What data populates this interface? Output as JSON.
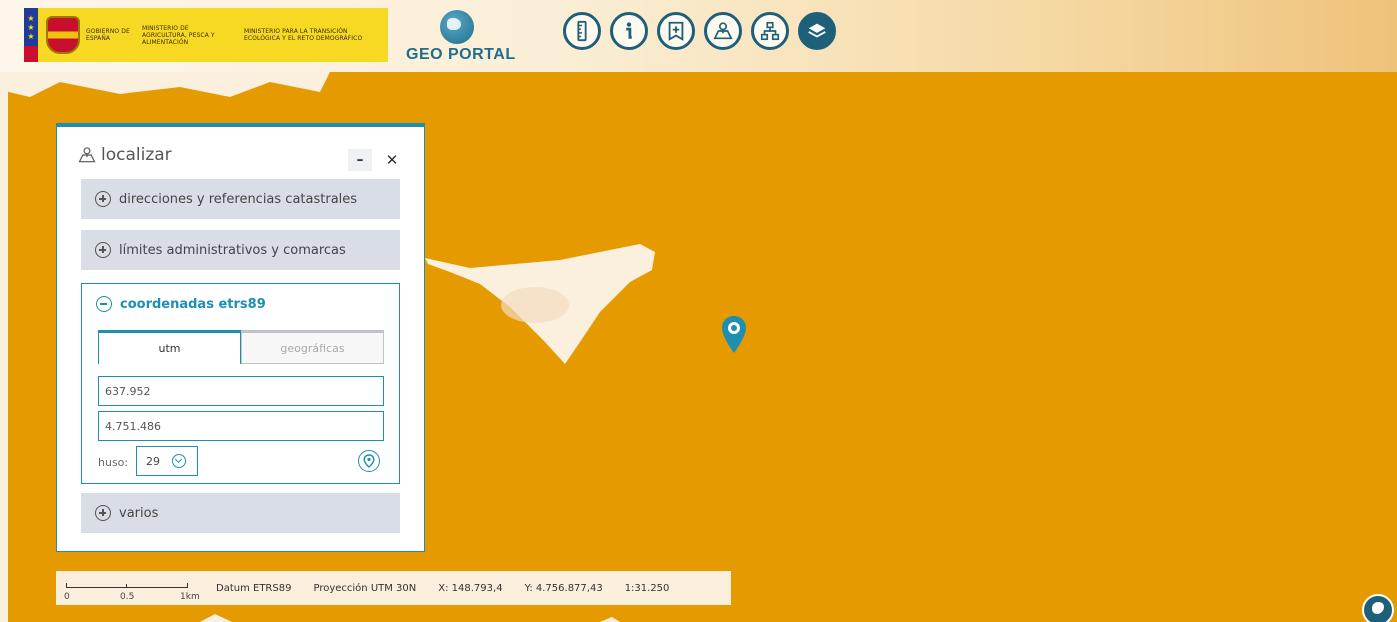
{
  "header": {
    "gov_texts": [
      "Gobierno de España",
      "Ministerio de Agricultura, Pesca y Alimentación",
      "Ministerio para la Transición Ecológica y el Reto Demográfico"
    ],
    "portal_title": "GEO PORTAL",
    "toolbar_icons": [
      "ruler-icon",
      "info-icon",
      "bookmark-icon",
      "map-search-icon",
      "sitemap-icon",
      "layers-icon"
    ]
  },
  "panel": {
    "title": "localizar",
    "minimize": "–",
    "close": "✕",
    "sections": {
      "addresses": "direcciones y referencias catastrales",
      "limits": "límites administrativos y comarcas",
      "coords": "coordenadas etrs89",
      "misc": "varios"
    },
    "tabs": {
      "utm": "utm",
      "geo": "geográficas"
    },
    "x_value": "637.952",
    "y_value": "4.751.486",
    "huso_label": "huso:",
    "huso_value": "29"
  },
  "statusbar": {
    "scale_labels": [
      "0",
      "0.5",
      "1km"
    ],
    "datum": "Datum ETRS89",
    "projection": "Proyección UTM 30N",
    "x": "X: 148.793,4",
    "y": "Y: 4.756.877,43",
    "scale": "1:31.250"
  },
  "colors": {
    "map": "#e59a00",
    "accent": "#1e8fb0",
    "land": "#fbf0de"
  }
}
